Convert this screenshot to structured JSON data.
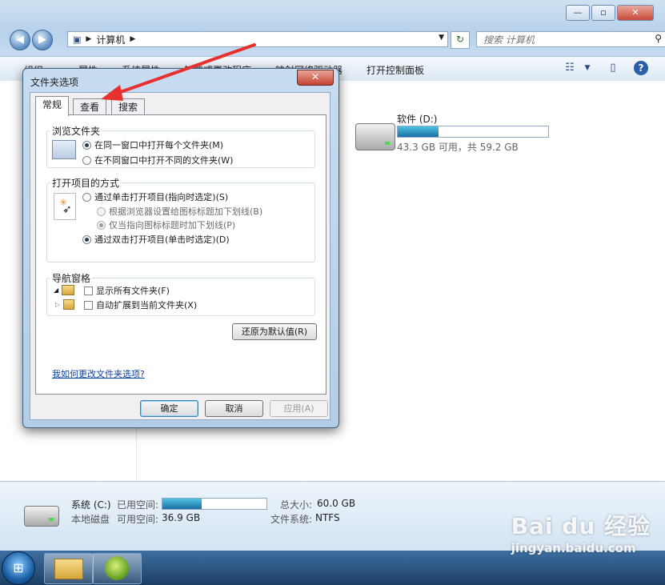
{
  "window": {
    "title_controls": {
      "minimize": "—",
      "maximize": "▫",
      "close": "✕"
    }
  },
  "address_bar": {
    "segment": "计算机",
    "search_placeholder": "搜索 计算机"
  },
  "toolbar": {
    "items": [
      "组织 ▾",
      "属性",
      "系统属性",
      "卸载或更改程序",
      "映射网络驱动器",
      "打开控制面板"
    ]
  },
  "drive_d": {
    "name": "软件 (D:)",
    "free_text": "43.3 GB 可用，共 59.2 GB",
    "used_fraction": 0.27
  },
  "status": {
    "drive_name": "系统 (C:)",
    "drive_type": "本地磁盘",
    "used_label": "已用空间:",
    "free_label": "可用空间:",
    "free_value": "36.9 GB",
    "used_fraction": 0.38,
    "total_label": "总大小:",
    "total_value": "60.0 GB",
    "fs_label": "文件系统:",
    "fs_value": "NTFS"
  },
  "dialog": {
    "title": "文件夹选项",
    "close": "✕",
    "tabs": [
      "常规",
      "查看",
      "搜索"
    ],
    "browse_group": {
      "title": "浏览文件夹",
      "opt1": "在同一窗口中打开每个文件夹(M)",
      "opt2": "在不同窗口中打开不同的文件夹(W)"
    },
    "click_group": {
      "title": "打开项目的方式",
      "opt1": "通过单击打开项目(指向时选定)(S)",
      "sub1": "根据浏览器设置给图标标题加下划线(B)",
      "sub2": "仅当指向图标标题时加下划线(P)",
      "opt2": "通过双击打开项目(单击时选定)(D)"
    },
    "nav_group": {
      "title": "导航窗格",
      "opt1": "显示所有文件夹(F)",
      "opt2": "自动扩展到当前文件夹(X)"
    },
    "restore_button": "还原为默认值(R)",
    "help_link": "我如何更改文件夹选项?",
    "ok": "确定",
    "cancel": "取消",
    "apply": "应用(A)"
  },
  "watermark": {
    "logo": "Bai du 经验",
    "url": "jingyan.baidu.com"
  },
  "colors": {
    "accent_arrow": "#e8302f",
    "progress_fill": "#1b6fa6"
  }
}
